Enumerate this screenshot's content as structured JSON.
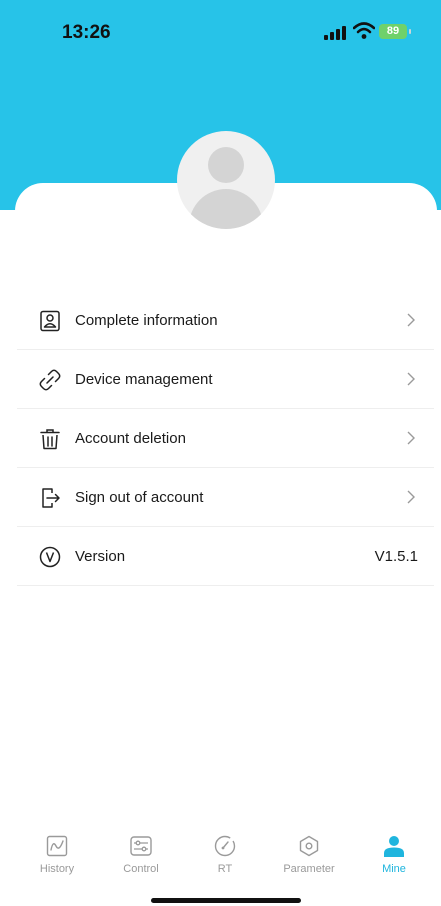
{
  "status_bar": {
    "time": "13:26",
    "battery": "89"
  },
  "profile": {
    "avatar_icon": "user-avatar-icon"
  },
  "menu": {
    "items": [
      {
        "label": "Complete information",
        "icon": "id-card-icon"
      },
      {
        "label": "Device management",
        "icon": "unlink-icon"
      },
      {
        "label": "Account deletion",
        "icon": "trash-icon"
      },
      {
        "label": "Sign out of account",
        "icon": "logout-icon"
      }
    ],
    "version": {
      "label": "Version",
      "value": "V1.5.1",
      "icon": "version-icon"
    }
  },
  "tabbar": {
    "tabs": [
      {
        "label": "History",
        "icon": "chart-line-icon"
      },
      {
        "label": "Control",
        "icon": "sliders-icon"
      },
      {
        "label": "RT",
        "icon": "gauge-icon"
      },
      {
        "label": "Parameter",
        "icon": "hexagon-icon"
      },
      {
        "label": "Mine",
        "icon": "user-icon",
        "active": true
      }
    ]
  },
  "colors": {
    "header": "#27c3e8",
    "active_tab": "#1fb5de"
  }
}
